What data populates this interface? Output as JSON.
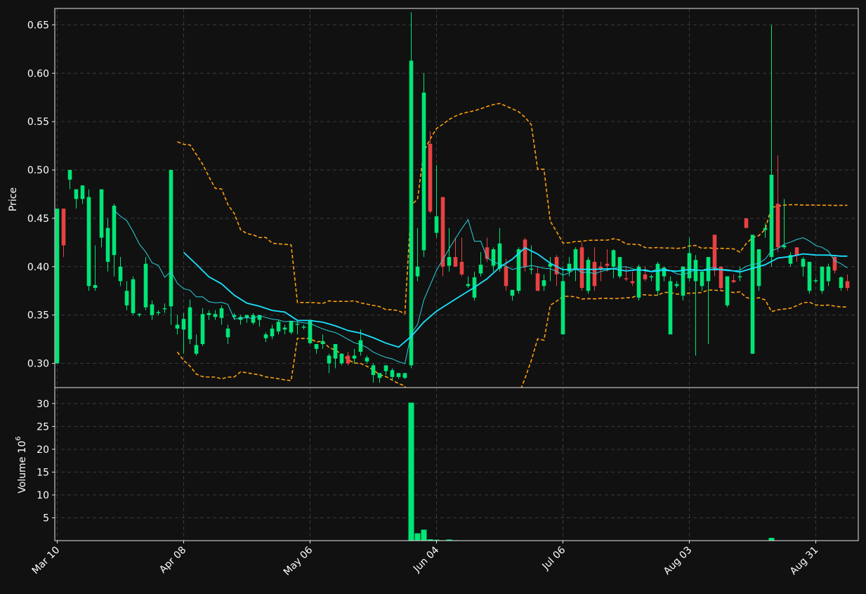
{
  "chart_data": {
    "type": "candlestick",
    "colors": {
      "up": "#00e676",
      "down": "#e84142",
      "ma_fast": "#2ad2de",
      "ma_slow": "#19e3ff",
      "band": "#ff9f0a",
      "background": "#111111",
      "grid": "#3a3a3a"
    },
    "price_axis": {
      "label": "Price",
      "ylim": [
        0.275,
        0.667
      ],
      "ticks": [
        "0.30",
        "0.35",
        "0.40",
        "0.45",
        "0.50",
        "0.55",
        "0.60",
        "0.65"
      ]
    },
    "volume_axis": {
      "label": "Volume",
      "exponent": "10",
      "exponent_power": "6",
      "ylim": [
        0,
        33.5
      ],
      "ticks": [
        "5",
        "10",
        "15",
        "20",
        "25",
        "30"
      ]
    },
    "x_ticks": [
      {
        "label": "Mar 10",
        "index": 0
      },
      {
        "label": "Apr 08",
        "index": 20
      },
      {
        "label": "May 06",
        "index": 40
      },
      {
        "label": "Jun 04",
        "index": 60
      },
      {
        "label": "Jul 06",
        "index": 80
      },
      {
        "label": "Aug 03",
        "index": 100
      },
      {
        "label": "Aug 31",
        "index": 120
      }
    ],
    "grid": true,
    "candles": [
      [
        0.3,
        0.46,
        0.3,
        0.46,
        0
      ],
      [
        0.46,
        0.46,
        0.41,
        0.422,
        0
      ],
      [
        0.49,
        0.5,
        0.48,
        0.5,
        0
      ],
      [
        0.47,
        0.48,
        0.46,
        0.48,
        0
      ],
      [
        0.47,
        0.484,
        0.465,
        0.484,
        0
      ],
      [
        0.38,
        0.48,
        0.375,
        0.472,
        0
      ],
      [
        0.378,
        0.422,
        0.375,
        0.381,
        0
      ],
      [
        0.43,
        0.48,
        0.42,
        0.48,
        0
      ],
      [
        0.405,
        0.45,
        0.395,
        0.44,
        0
      ],
      [
        0.412,
        0.465,
        0.39,
        0.463,
        0
      ],
      [
        0.385,
        0.41,
        0.38,
        0.4,
        0
      ],
      [
        0.36,
        0.385,
        0.355,
        0.375,
        0
      ],
      [
        0.352,
        0.39,
        0.35,
        0.387,
        0
      ],
      [
        0.35,
        0.352,
        0.348,
        0.351,
        0
      ],
      [
        0.358,
        0.41,
        0.355,
        0.403,
        0
      ],
      [
        0.35,
        0.365,
        0.345,
        0.361,
        0
      ],
      [
        0.352,
        0.355,
        0.35,
        0.353,
        0
      ],
      [
        0.356,
        0.362,
        0.352,
        0.357,
        0
      ],
      [
        0.359,
        0.5,
        0.34,
        0.5,
        0
      ],
      [
        0.336,
        0.35,
        0.33,
        0.34,
        0
      ],
      [
        0.335,
        0.352,
        0.31,
        0.346,
        0
      ],
      [
        0.325,
        0.366,
        0.32,
        0.358,
        0
      ],
      [
        0.31,
        0.33,
        0.308,
        0.319,
        0
      ],
      [
        0.32,
        0.357,
        0.318,
        0.351,
        0
      ],
      [
        0.35,
        0.355,
        0.345,
        0.352,
        0
      ],
      [
        0.348,
        0.355,
        0.345,
        0.351,
        0
      ],
      [
        0.347,
        0.36,
        0.34,
        0.357,
        0
      ],
      [
        0.327,
        0.34,
        0.32,
        0.336,
        0
      ],
      [
        0.348,
        0.352,
        0.345,
        0.35,
        0
      ],
      [
        0.345,
        0.35,
        0.34,
        0.348,
        0
      ],
      [
        0.347,
        0.35,
        0.342,
        0.35,
        0
      ],
      [
        0.342,
        0.352,
        0.34,
        0.35,
        0
      ],
      [
        0.345,
        0.35,
        0.338,
        0.35,
        0
      ],
      [
        0.326,
        0.332,
        0.322,
        0.33,
        0
      ],
      [
        0.328,
        0.34,
        0.325,
        0.336,
        0
      ],
      [
        0.333,
        0.345,
        0.33,
        0.343,
        0
      ],
      [
        0.335,
        0.34,
        0.33,
        0.337,
        0
      ],
      [
        0.332,
        0.344,
        0.33,
        0.344,
        0
      ],
      [
        0.34,
        0.344,
        0.33,
        0.341,
        0
      ],
      [
        0.338,
        0.34,
        0.335,
        0.338,
        0
      ],
      [
        0.321,
        0.342,
        0.32,
        0.345,
        0
      ],
      [
        0.315,
        0.32,
        0.31,
        0.32,
        0
      ],
      [
        0.32,
        0.33,
        0.315,
        0.323,
        0
      ],
      [
        0.3,
        0.31,
        0.29,
        0.308,
        0
      ],
      [
        0.305,
        0.32,
        0.295,
        0.32,
        0
      ],
      [
        0.3,
        0.31,
        0.298,
        0.31,
        0
      ],
      [
        0.308,
        0.312,
        0.298,
        0.3,
        0
      ],
      [
        0.305,
        0.315,
        0.3,
        0.308,
        0
      ],
      [
        0.312,
        0.335,
        0.308,
        0.324,
        0
      ],
      [
        0.302,
        0.308,
        0.3,
        0.306,
        0
      ],
      [
        0.288,
        0.3,
        0.28,
        0.298,
        0
      ],
      [
        0.285,
        0.29,
        0.28,
        0.29,
        0
      ],
      [
        0.292,
        0.298,
        0.288,
        0.298,
        0
      ],
      [
        0.286,
        0.295,
        0.282,
        0.293,
        0
      ],
      [
        0.286,
        0.29,
        0.284,
        0.29,
        0
      ],
      [
        0.285,
        0.29,
        0.284,
        0.29,
        0
      ],
      [
        0.298,
        0.663,
        0.295,
        0.613,
        30.2
      ],
      [
        0.39,
        0.44,
        0.385,
        0.4,
        1.6
      ],
      [
        0.417,
        0.6,
        0.41,
        0.58,
        2.4
      ],
      [
        0.527,
        0.54,
        0.455,
        0.457,
        0.3
      ],
      [
        0.435,
        0.505,
        0.43,
        0.452,
        0.2
      ],
      [
        0.472,
        0.472,
        0.39,
        0.4,
        0.1
      ],
      [
        0.401,
        0.44,
        0.395,
        0.41,
        0.25
      ],
      [
        0.41,
        0.43,
        0.4,
        0.4,
        0.1
      ],
      [
        0.405,
        0.43,
        0.39,
        0.392,
        0.05
      ],
      [
        0.38,
        0.39,
        0.378,
        0.382,
        0.05
      ],
      [
        0.368,
        0.395,
        0.365,
        0.389,
        0.05
      ],
      [
        0.393,
        0.415,
        0.39,
        0.402,
        0.05
      ],
      [
        0.42,
        0.43,
        0.405,
        0.408,
        0.05
      ],
      [
        0.401,
        0.42,
        0.395,
        0.418,
        0.05
      ],
      [
        0.398,
        0.44,
        0.395,
        0.424,
        0.05
      ],
      [
        0.4,
        0.408,
        0.375,
        0.38,
        0.05
      ],
      [
        0.37,
        0.376,
        0.365,
        0.376,
        0.05
      ],
      [
        0.375,
        0.42,
        0.372,
        0.418,
        0.05
      ],
      [
        0.428,
        0.43,
        0.395,
        0.4,
        0.05
      ],
      [
        0.398,
        0.422,
        0.392,
        0.398,
        0.05
      ],
      [
        0.393,
        0.4,
        0.375,
        0.375,
        0.05
      ],
      [
        0.38,
        0.392,
        0.375,
        0.386,
        0.05
      ],
      [
        0.4,
        0.41,
        0.385,
        0.403,
        0.05
      ],
      [
        0.41,
        0.412,
        0.38,
        0.392,
        0.05
      ],
      [
        0.33,
        0.4,
        0.33,
        0.385,
        0.05
      ],
      [
        0.395,
        0.41,
        0.39,
        0.403,
        0.05
      ],
      [
        0.398,
        0.42,
        0.385,
        0.418,
        0.05
      ],
      [
        0.42,
        0.425,
        0.375,
        0.378,
        0.05
      ],
      [
        0.375,
        0.41,
        0.372,
        0.407,
        0.05
      ],
      [
        0.405,
        0.42,
        0.375,
        0.38,
        0.05
      ],
      [
        0.4,
        0.405,
        0.385,
        0.398,
        0.05
      ],
      [
        0.403,
        0.418,
        0.395,
        0.401,
        0.05
      ],
      [
        0.4,
        0.418,
        0.388,
        0.417,
        0.05
      ],
      [
        0.39,
        0.41,
        0.388,
        0.41,
        0.05
      ],
      [
        0.388,
        0.4,
        0.385,
        0.387,
        0.05
      ],
      [
        0.385,
        0.395,
        0.38,
        0.383,
        0.05
      ],
      [
        0.368,
        0.402,
        0.365,
        0.4,
        0.05
      ],
      [
        0.392,
        0.4,
        0.385,
        0.387,
        0.05
      ],
      [
        0.39,
        0.392,
        0.385,
        0.39,
        0.05
      ],
      [
        0.375,
        0.405,
        0.37,
        0.403,
        0.05
      ],
      [
        0.39,
        0.4,
        0.385,
        0.399,
        0.05
      ],
      [
        0.33,
        0.39,
        0.33,
        0.385,
        0.05
      ],
      [
        0.38,
        0.385,
        0.378,
        0.382,
        0.05
      ],
      [
        0.37,
        0.4,
        0.365,
        0.4,
        0.05
      ],
      [
        0.388,
        0.43,
        0.385,
        0.414,
        0.05
      ],
      [
        0.385,
        0.412,
        0.308,
        0.407,
        0.05
      ],
      [
        0.38,
        0.395,
        0.375,
        0.395,
        0.05
      ],
      [
        0.385,
        0.41,
        0.32,
        0.41,
        0.05
      ],
      [
        0.433,
        0.433,
        0.39,
        0.396,
        0.05
      ],
      [
        0.4,
        0.4,
        0.375,
        0.378,
        0.05
      ],
      [
        0.36,
        0.39,
        0.358,
        0.39,
        0.05
      ],
      [
        0.386,
        0.392,
        0.383,
        0.384,
        0.05
      ],
      [
        0.39,
        0.4,
        0.385,
        0.39,
        0.05
      ],
      [
        0.45,
        0.45,
        0.44,
        0.44,
        0.05
      ],
      [
        0.31,
        0.43,
        0.31,
        0.433,
        0.05
      ],
      [
        0.38,
        0.418,
        0.375,
        0.418,
        0.05
      ],
      [
        0.438,
        0.445,
        0.43,
        0.44,
        0.05
      ],
      [
        0.41,
        0.65,
        0.4,
        0.495,
        0.6
      ],
      [
        0.465,
        0.515,
        0.415,
        0.42,
        0.05
      ],
      [
        0.42,
        0.47,
        0.418,
        0.422,
        0.05
      ],
      [
        0.403,
        0.415,
        0.4,
        0.412,
        0.05
      ],
      [
        0.42,
        0.42,
        0.405,
        0.412,
        0.05
      ],
      [
        0.4,
        0.41,
        0.39,
        0.408,
        0.05
      ],
      [
        0.375,
        0.405,
        0.372,
        0.405,
        0.05
      ],
      [
        0.385,
        0.388,
        0.383,
        0.386,
        0.05
      ],
      [
        0.375,
        0.4,
        0.372,
        0.4,
        0.05
      ],
      [
        0.385,
        0.403,
        0.38,
        0.4,
        0.05
      ],
      [
        0.41,
        0.412,
        0.393,
        0.396,
        0.05
      ],
      [
        0.378,
        0.39,
        0.375,
        0.389,
        0.05
      ],
      [
        0.385,
        0.392,
        0.375,
        0.378,
        0.05
      ]
    ]
  }
}
